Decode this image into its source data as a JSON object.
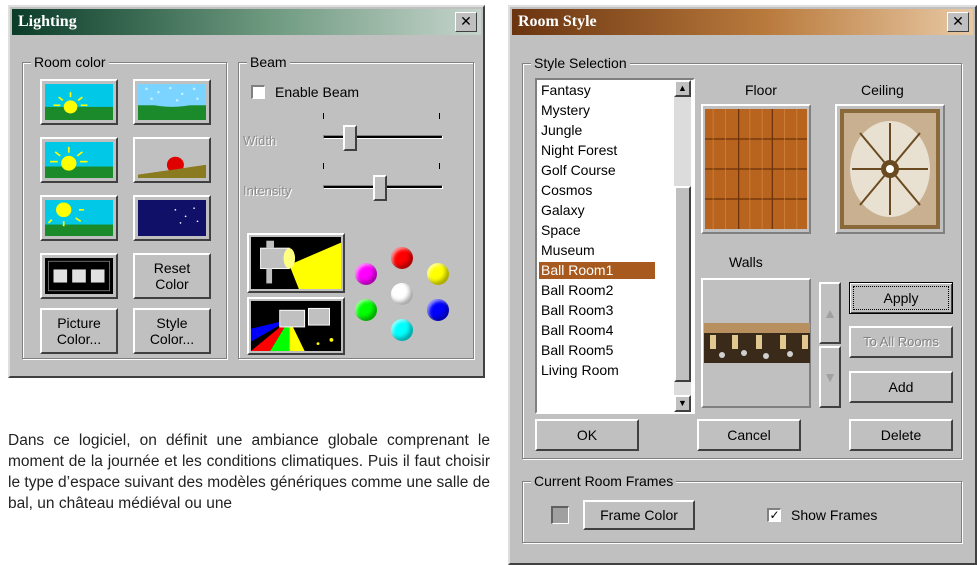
{
  "lighting": {
    "title": "Lighting",
    "close_glyph": "✕",
    "room_color": {
      "legend": "Room color",
      "presets": [
        {
          "icon": "daytime-sun-icon"
        },
        {
          "icon": "overcast-sky-icon"
        },
        {
          "icon": "rising-sun-icon"
        },
        {
          "icon": "sunset-icon"
        },
        {
          "icon": "bright-sun-icon"
        },
        {
          "icon": "night-moon-icon"
        }
      ],
      "dark_room_icon": "dark-room-icon",
      "reset_color": "Reset\nColor",
      "picture_color": "Picture\nColor...",
      "style_color": "Style\nColor..."
    },
    "beam": {
      "legend": "Beam",
      "enable_label": "Enable Beam",
      "enable_checked": false,
      "width_label": "Width",
      "intensity_label": "Intensity",
      "width_value": 0.2,
      "intensity_value": 0.4,
      "spotlight_icon": "spotlight-icon",
      "multispot_icon": "multicolor-spotlight-icon",
      "colors": [
        "#ff00ff",
        "#ff0000",
        "#ffff00",
        "#00ff00",
        "#ffffff",
        "#0000ff",
        "#00ffff"
      ]
    }
  },
  "room_style": {
    "title": "Room Style",
    "close_glyph": "✕",
    "style_selection": {
      "legend": "Style Selection",
      "items": [
        "Fantasy",
        "Mystery",
        "Jungle",
        "Night Forest",
        "Golf Course",
        "Cosmos",
        "Galaxy",
        "Space",
        "Museum",
        "Ball Room1",
        "Ball Room2",
        "Ball Room3",
        "Ball Room4",
        "Ball Room5",
        "Living Room"
      ],
      "selected": "Ball Room1"
    },
    "floor_label": "Floor",
    "ceiling_label": "Ceiling",
    "walls_label": "Walls",
    "apply": "Apply",
    "to_all_rooms": "To All Rooms",
    "add": "Add",
    "ok": "OK",
    "cancel": "Cancel",
    "delete": "Delete",
    "frames": {
      "legend": "Current Room Frames",
      "frame_color": "Frame Color",
      "show_frames": "Show Frames",
      "show_frames_checked": true,
      "check_glyph": "✓"
    }
  },
  "description": "Dans ce logiciel, on définit une ambiance globale comprenant le moment de la journée et les conditions climatiques. Puis il faut choisir le type d’espace suivant des modèles génériques comme une salle de bal, un château médiéval ou une"
}
